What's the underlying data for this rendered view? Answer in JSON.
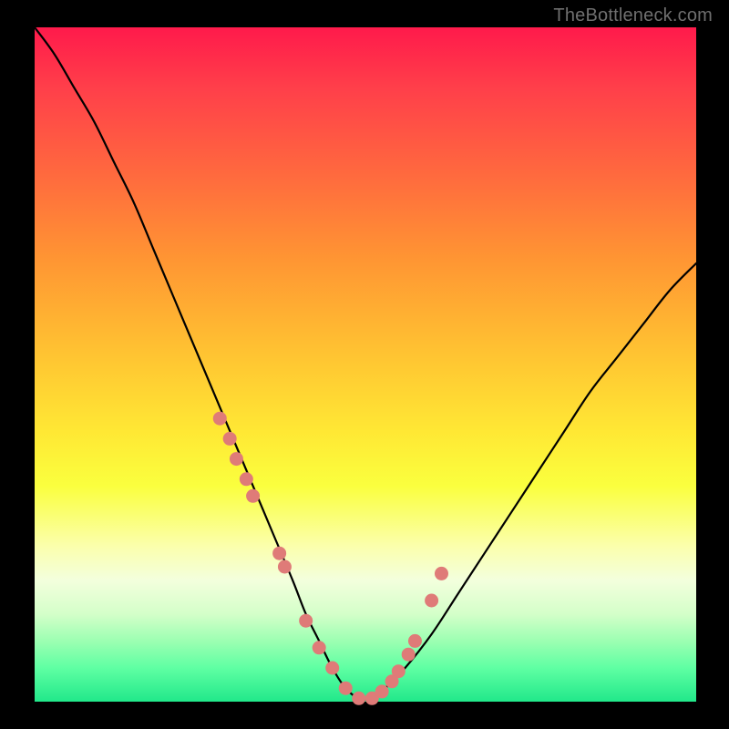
{
  "watermark": "TheBottleneck.com",
  "chart_data": {
    "type": "line",
    "title": "",
    "xlabel": "",
    "ylabel": "",
    "xlim": [
      0,
      100
    ],
    "ylim": [
      0,
      100
    ],
    "grid": false,
    "series": [
      {
        "name": "bottleneck-curve",
        "x": [
          0,
          3,
          6,
          9,
          12,
          15,
          18,
          21,
          24,
          27,
          30,
          33,
          36,
          39,
          41,
          43,
          45,
          47,
          49,
          51,
          53,
          56,
          60,
          64,
          68,
          72,
          76,
          80,
          84,
          88,
          92,
          96,
          100
        ],
        "y": [
          100,
          96,
          91,
          86,
          80,
          74,
          67,
          60,
          53,
          46,
          39,
          32,
          25,
          18,
          13,
          9,
          5,
          2,
          0.5,
          0.5,
          2,
          5,
          10,
          16,
          22,
          28,
          34,
          40,
          46,
          51,
          56,
          61,
          65
        ]
      }
    ],
    "markers": {
      "name": "highlight-points",
      "color": "#df7b78",
      "x": [
        28,
        29.5,
        30.5,
        32,
        33,
        37,
        37.8,
        41,
        43,
        45,
        47,
        49,
        51,
        52.5,
        54,
        55,
        56.5,
        57.5,
        60,
        61.5
      ],
      "y": [
        42,
        39,
        36,
        33,
        30.5,
        22,
        20,
        12,
        8,
        5,
        2,
        0.5,
        0.5,
        1.5,
        3,
        4.5,
        7,
        9,
        15,
        19
      ]
    },
    "background_gradient": {
      "stops": [
        {
          "pos": 0.0,
          "color": "#ff1a4b"
        },
        {
          "pos": 0.09,
          "color": "#ff3f4a"
        },
        {
          "pos": 0.22,
          "color": "#ff6a3e"
        },
        {
          "pos": 0.34,
          "color": "#ff9433"
        },
        {
          "pos": 0.48,
          "color": "#ffc232"
        },
        {
          "pos": 0.6,
          "color": "#ffe834"
        },
        {
          "pos": 0.68,
          "color": "#faff3e"
        },
        {
          "pos": 0.77,
          "color": "#fbffad"
        },
        {
          "pos": 0.82,
          "color": "#f3ffdd"
        },
        {
          "pos": 0.87,
          "color": "#d4ffc9"
        },
        {
          "pos": 0.91,
          "color": "#9cffb2"
        },
        {
          "pos": 0.95,
          "color": "#5fffa3"
        },
        {
          "pos": 1.0,
          "color": "#21e88a"
        }
      ]
    }
  }
}
